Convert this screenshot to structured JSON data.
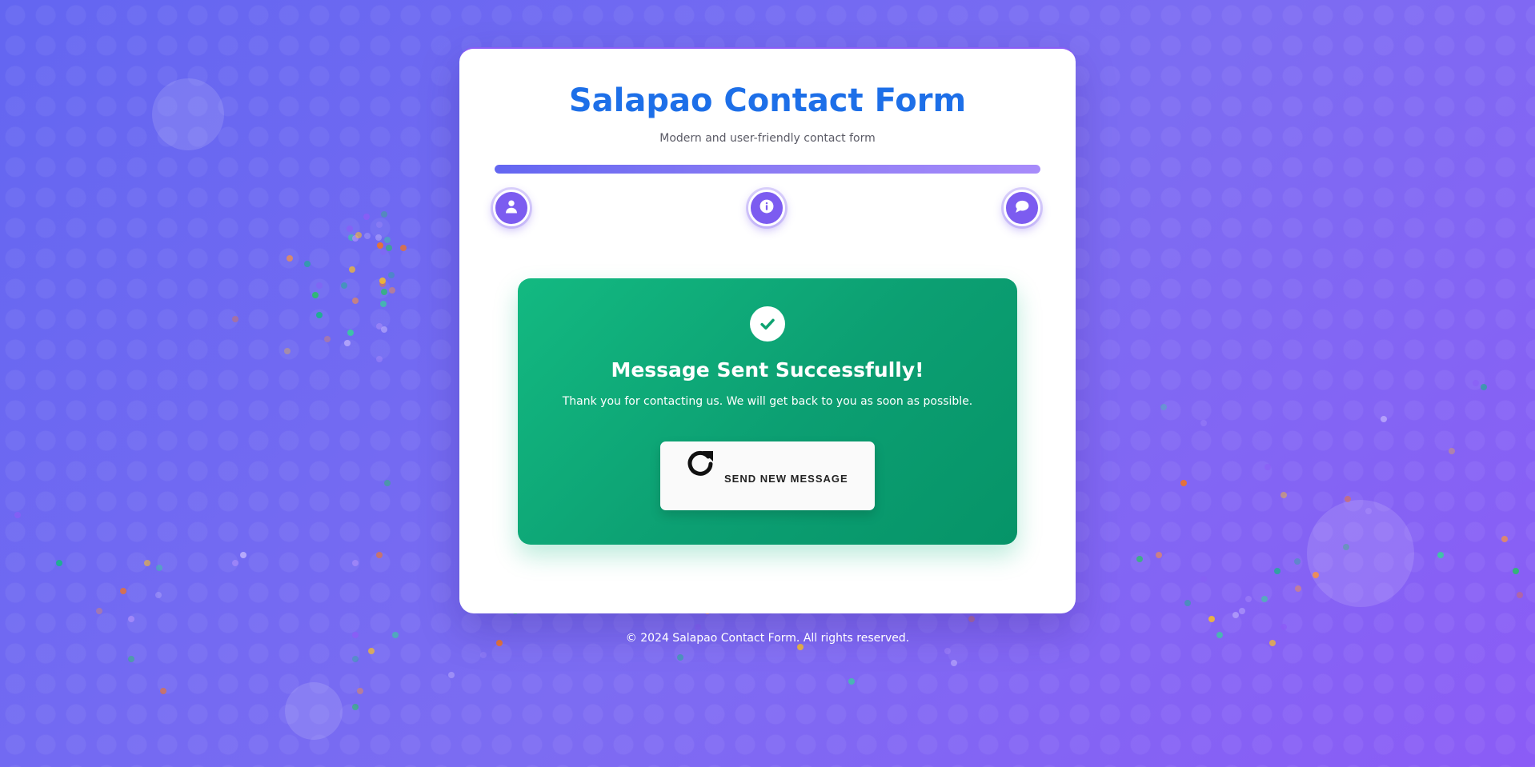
{
  "form": {
    "title": "Salapao Contact Form",
    "subtitle": "Modern and user-friendly contact form",
    "progress_percent": 100,
    "steps": [
      {
        "icon": "user-icon"
      },
      {
        "icon": "info-icon"
      },
      {
        "icon": "comment-icon"
      }
    ]
  },
  "success": {
    "icon": "check-icon",
    "title": "Message Sent Successfully!",
    "message": "Thank you for contacting us. We will get back to you as soon as possible.",
    "button_icon": "refresh-icon",
    "button_label": "SEND NEW MESSAGE"
  },
  "footer": {
    "text": "© 2024 Salapao Contact Form. All rights reserved."
  },
  "colors": {
    "accent": "#1d6fe8",
    "primary": "#7c5cf0",
    "success": "#10b981",
    "background_start": "#6366f1",
    "background_end": "#8b5cf6"
  }
}
